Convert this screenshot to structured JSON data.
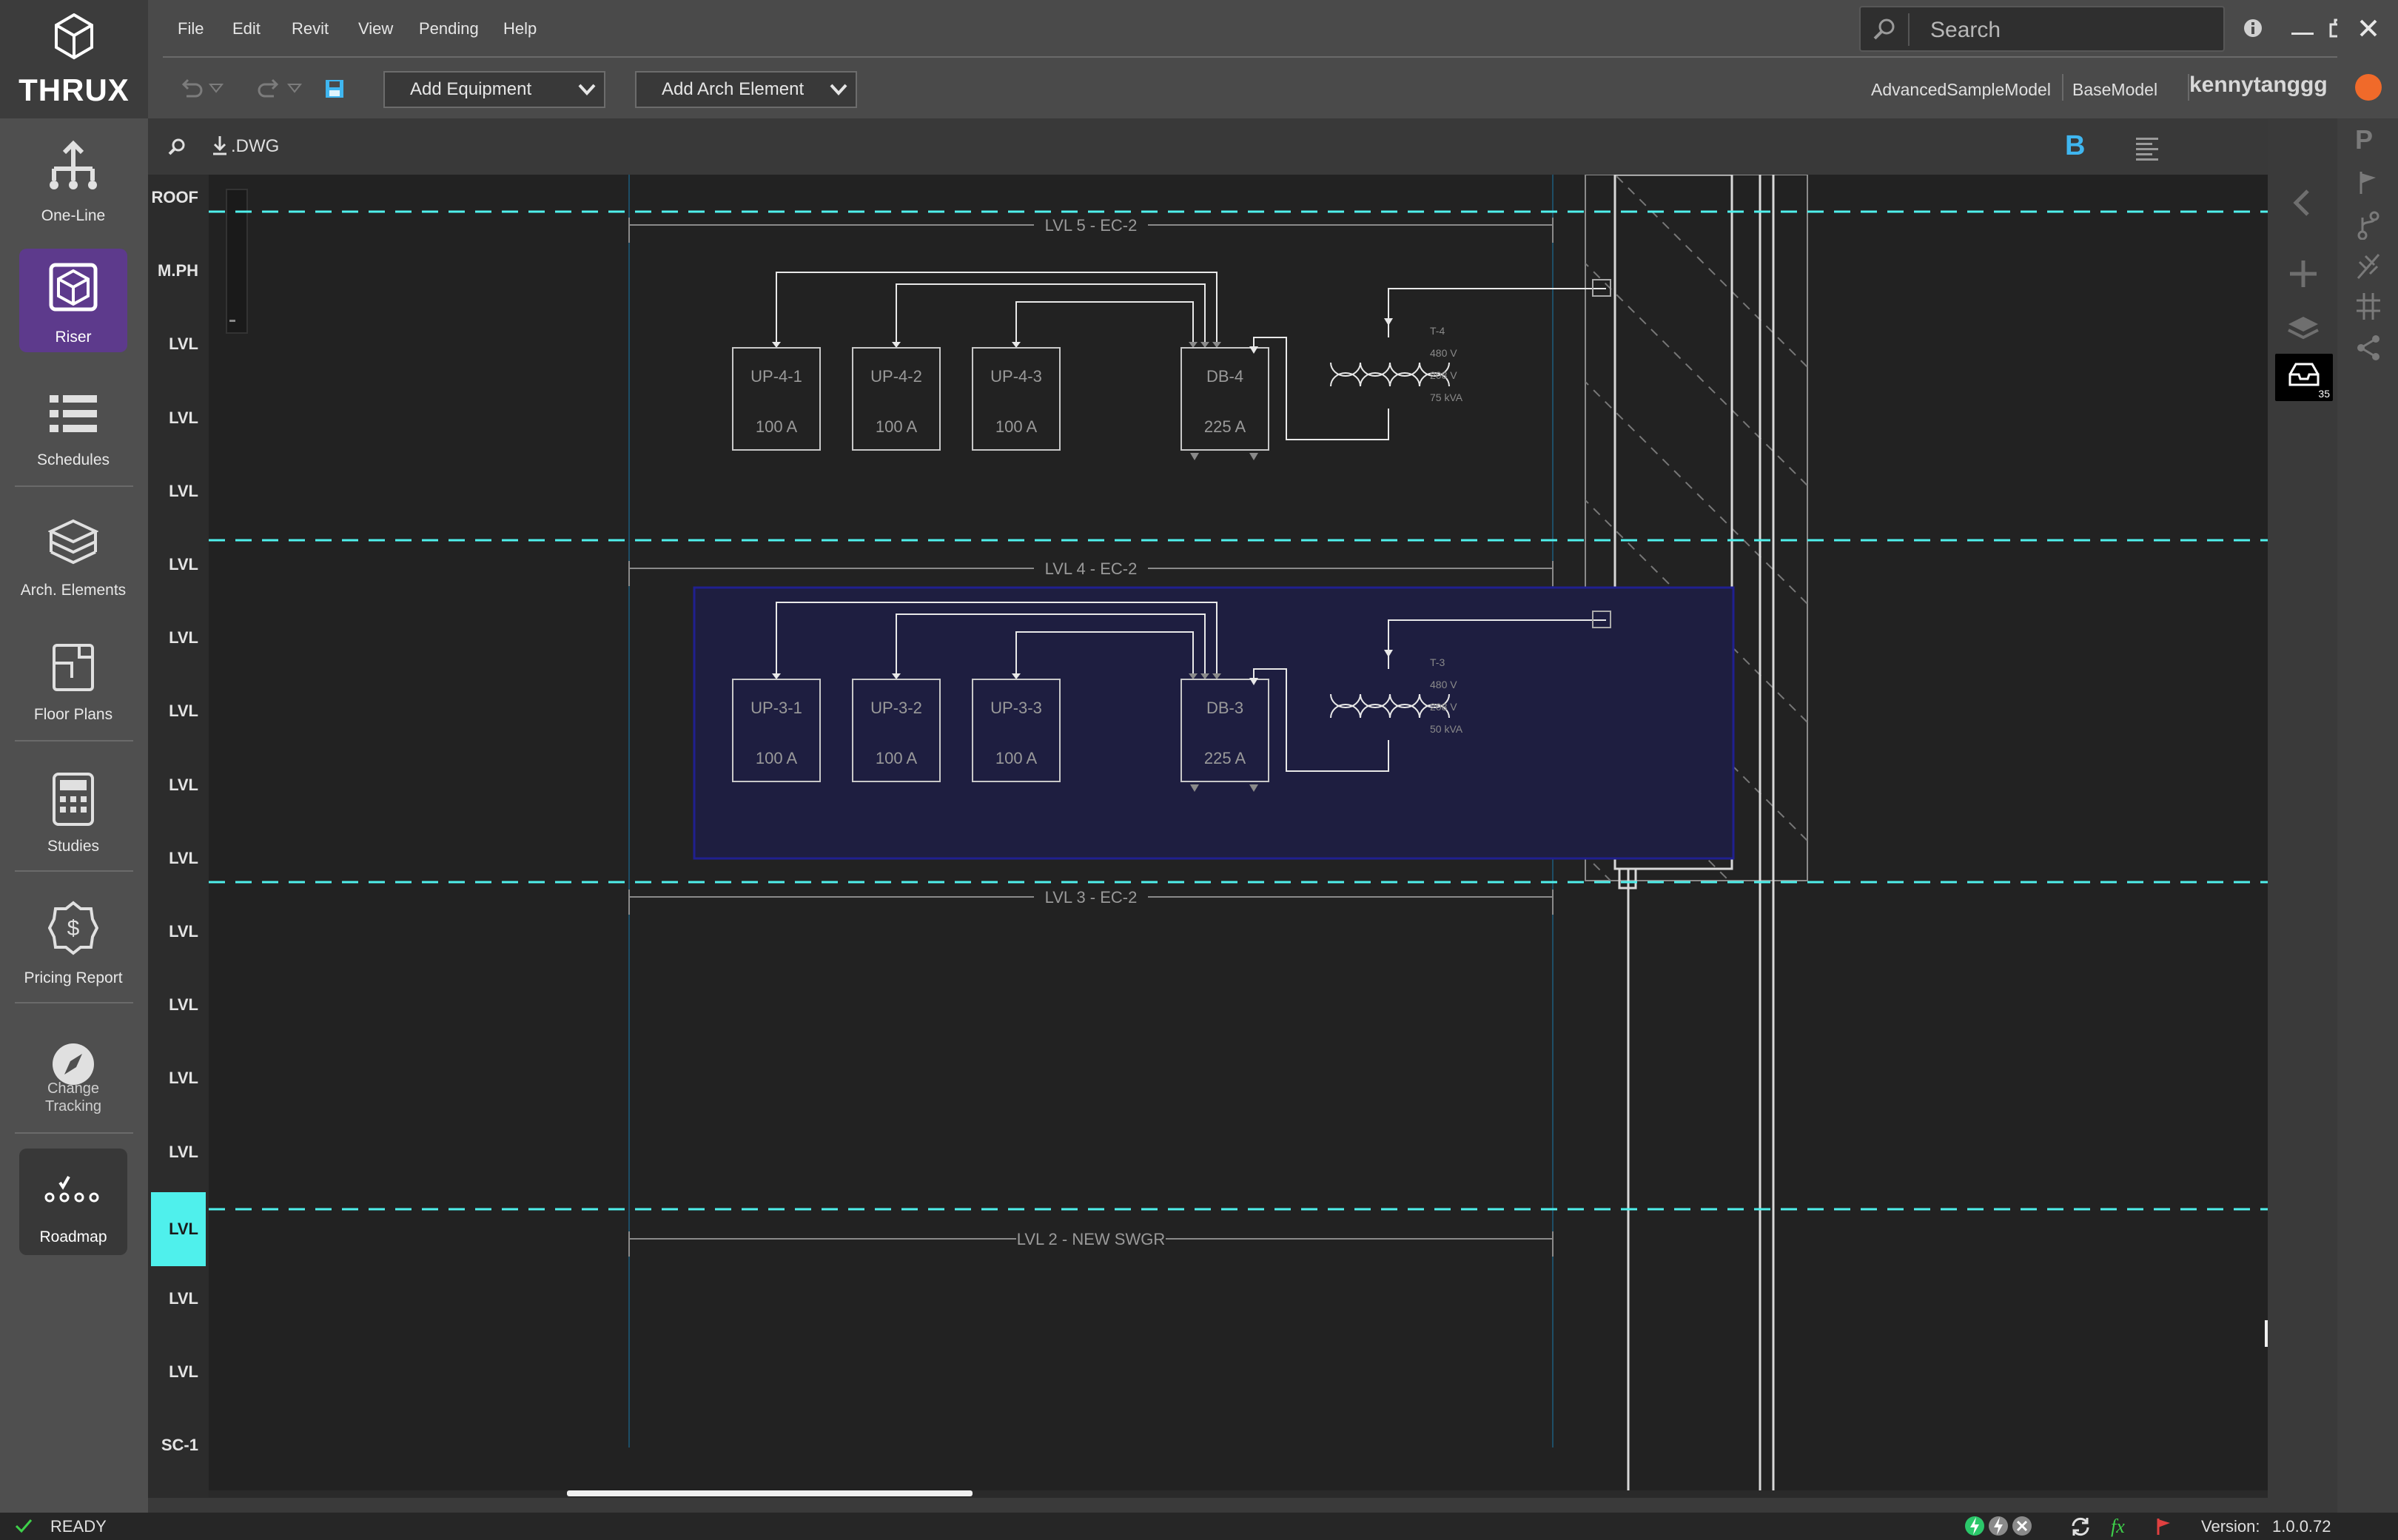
{
  "app": {
    "logo": "THRUX"
  },
  "nav": {
    "items": [
      {
        "label": "One-Line"
      },
      {
        "label": "Riser"
      },
      {
        "label": "Schedules"
      },
      {
        "label": "Arch. Elements"
      },
      {
        "label": "Floor Plans"
      },
      {
        "label": "Studies"
      },
      {
        "label": "Pricing Report"
      },
      {
        "label": "Change",
        "label2": "Tracking"
      },
      {
        "label": "Roadmap"
      }
    ]
  },
  "menu": [
    "File",
    "Edit",
    "Revit",
    "View",
    "Pending",
    "Help"
  ],
  "toolbar": {
    "add_equipment": "Add Equipment",
    "add_arch": "Add Arch Element"
  },
  "search": {
    "placeholder": "Search"
  },
  "breadcrumb": {
    "model": "AdvancedSampleModel",
    "base": "BaseModel",
    "user": "kennytanggg"
  },
  "canvas_toolbar": {
    "dwg": ".DWG",
    "b_label": "B"
  },
  "levels": [
    "ROOF",
    "M.PH",
    "LVL",
    "LVL",
    "LVL",
    "LVL",
    "LVL",
    "LVL",
    "LVL",
    "LVL",
    "LVL",
    "LVL",
    "LVL",
    "LVL",
    "LVL",
    "LVL",
    "LVL",
    "SC-1"
  ],
  "active_level_index": 14,
  "level_labels": [
    "LVL 5 - EC-2",
    "LVL 4 - EC-2",
    "LVL 3 - EC-2",
    "LVL 2 - NEW SWGR"
  ],
  "panels_top": [
    {
      "name": "UP-4-1",
      "rating": "100 A"
    },
    {
      "name": "UP-4-2",
      "rating": "100 A"
    },
    {
      "name": "UP-4-3",
      "rating": "100 A"
    },
    {
      "name": "DB-4",
      "rating": "225 A"
    }
  ],
  "panels_bottom": [
    {
      "name": "UP-3-1",
      "rating": "100 A"
    },
    {
      "name": "UP-3-2",
      "rating": "100 A"
    },
    {
      "name": "UP-3-3",
      "rating": "100 A"
    },
    {
      "name": "DB-3",
      "rating": "225 A"
    }
  ],
  "transformer_top": {
    "name": "T-4",
    "primary": "480 V",
    "secondary": "208 V",
    "rating": "75 kVA"
  },
  "transformer_bottom": {
    "name": "T-3",
    "primary": "480 V",
    "secondary": "208 V",
    "rating": "50 kVA"
  },
  "right_panel": {
    "badge": "35"
  },
  "status": {
    "text": "READY",
    "version_label": "Version:",
    "version": "1.0.0.72",
    "fx": "fx"
  },
  "colors": {
    "accent_cyan": "#4ff0ec",
    "riser_active": "#5d3a8c",
    "selection_fill": "#1e1e40",
    "selection_border": "#202090"
  }
}
